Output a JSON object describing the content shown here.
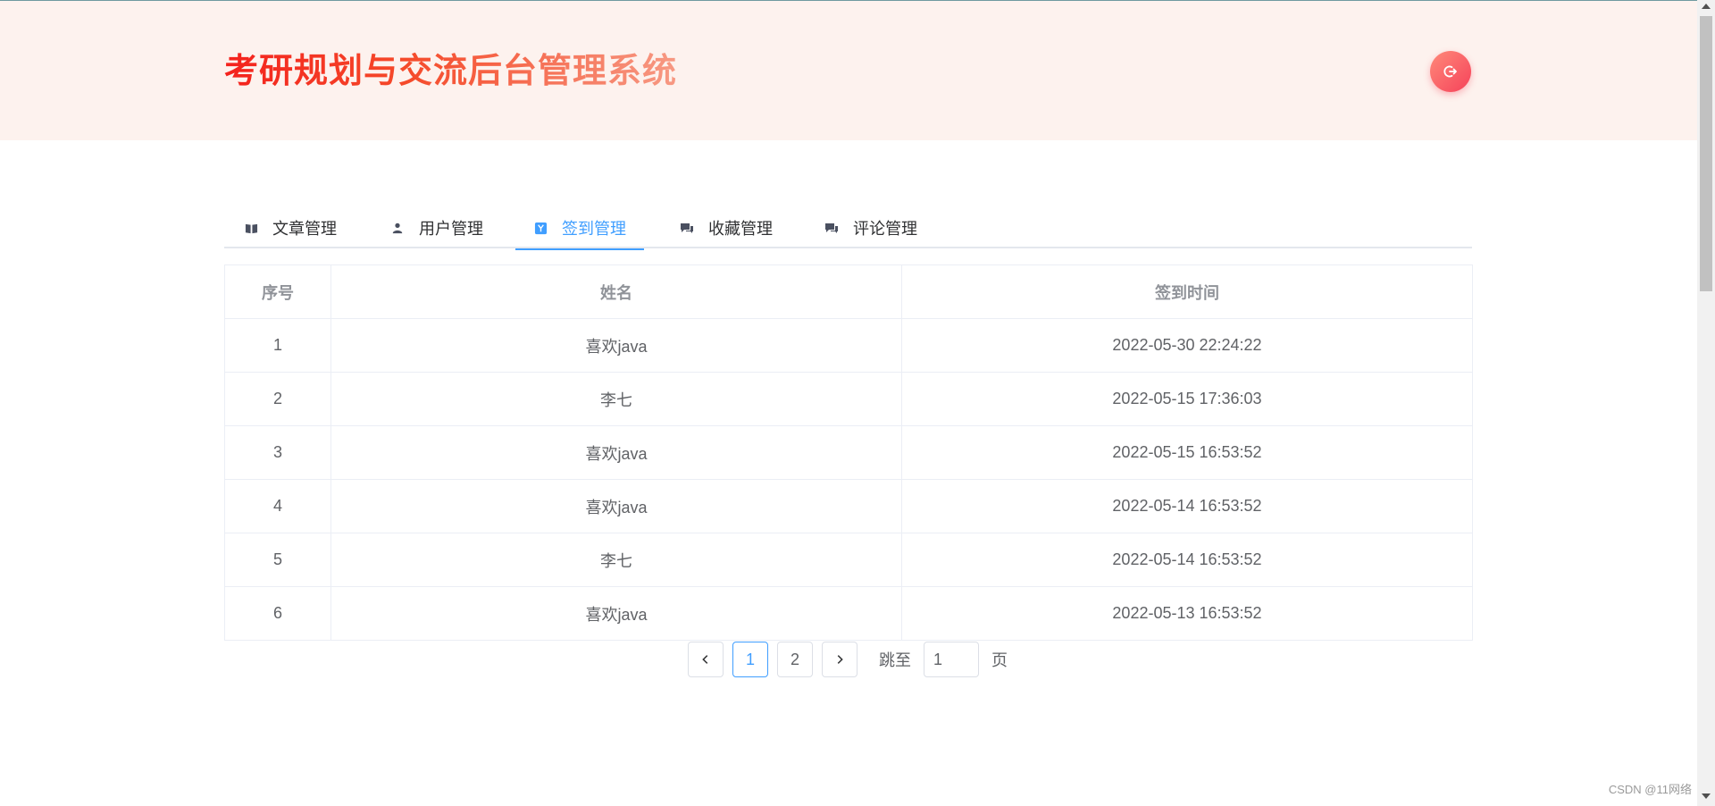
{
  "header": {
    "title": "考研规划与交流后台管理系统"
  },
  "tabs": [
    {
      "label": "文章管理",
      "icon": "book-icon"
    },
    {
      "label": "用户管理",
      "icon": "user-icon"
    },
    {
      "label": "签到管理",
      "icon": "checkin-icon",
      "active": true
    },
    {
      "label": "收藏管理",
      "icon": "chat-icon"
    },
    {
      "label": "评论管理",
      "icon": "chat-icon"
    }
  ],
  "table": {
    "columns": [
      "序号",
      "姓名",
      "签到时间"
    ],
    "rows": [
      [
        "1",
        "喜欢java",
        "2022-05-30 22:24:22"
      ],
      [
        "2",
        "李七",
        "2022-05-15 17:36:03"
      ],
      [
        "3",
        "喜欢java",
        "2022-05-15 16:53:52"
      ],
      [
        "4",
        "喜欢java",
        "2022-05-14 16:53:52"
      ],
      [
        "5",
        "李七",
        "2022-05-14 16:53:52"
      ],
      [
        "6",
        "喜欢java",
        "2022-05-13 16:53:52"
      ]
    ]
  },
  "pagination": {
    "pages": [
      "1",
      "2"
    ],
    "current": "1",
    "jump_label": "跳至",
    "jump_value": "1",
    "page_unit": "页"
  },
  "watermark": "CSDN @11网络",
  "colors": {
    "accent": "#409eff",
    "header_bg": "#fdf2ee",
    "title_start": "#f4221d",
    "title_end": "#f79983"
  }
}
